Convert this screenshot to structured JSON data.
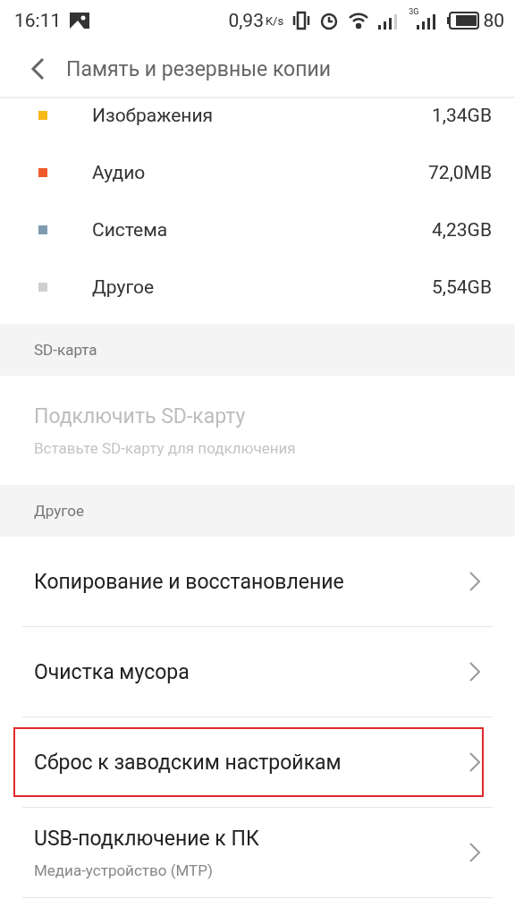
{
  "status_bar": {
    "time": "16:11",
    "speed": "0,93",
    "speed_unit": "K/s",
    "network_type": "3G",
    "battery": "80"
  },
  "header": {
    "title": "Память и резервные копии"
  },
  "storage": [
    {
      "label": "Изображения",
      "value": "1,34GB",
      "color": "#f7b81c"
    },
    {
      "label": "Аудио",
      "value": "72,0MB",
      "color": "#ee5a2a"
    },
    {
      "label": "Система",
      "value": "4,23GB",
      "color": "#7f9bb0"
    },
    {
      "label": "Другое",
      "value": "5,54GB",
      "color": "#cfcfcf"
    }
  ],
  "sd_section": {
    "heading": "SD-карта",
    "item": {
      "title": "Подключить SD-карту",
      "subtitle": "Вставьте SD-карту для подключения",
      "disabled": true
    }
  },
  "other_section": {
    "heading": "Другое",
    "items": [
      {
        "title": "Копирование и восстановление",
        "highlighted": false
      },
      {
        "title": "Очистка мусора",
        "highlighted": false
      },
      {
        "title": "Сброс к заводским настройкам",
        "highlighted": true
      },
      {
        "title": "USB-подключение к ПК",
        "subtitle": "Медиа-устройство (MTP)",
        "highlighted": false
      }
    ]
  }
}
